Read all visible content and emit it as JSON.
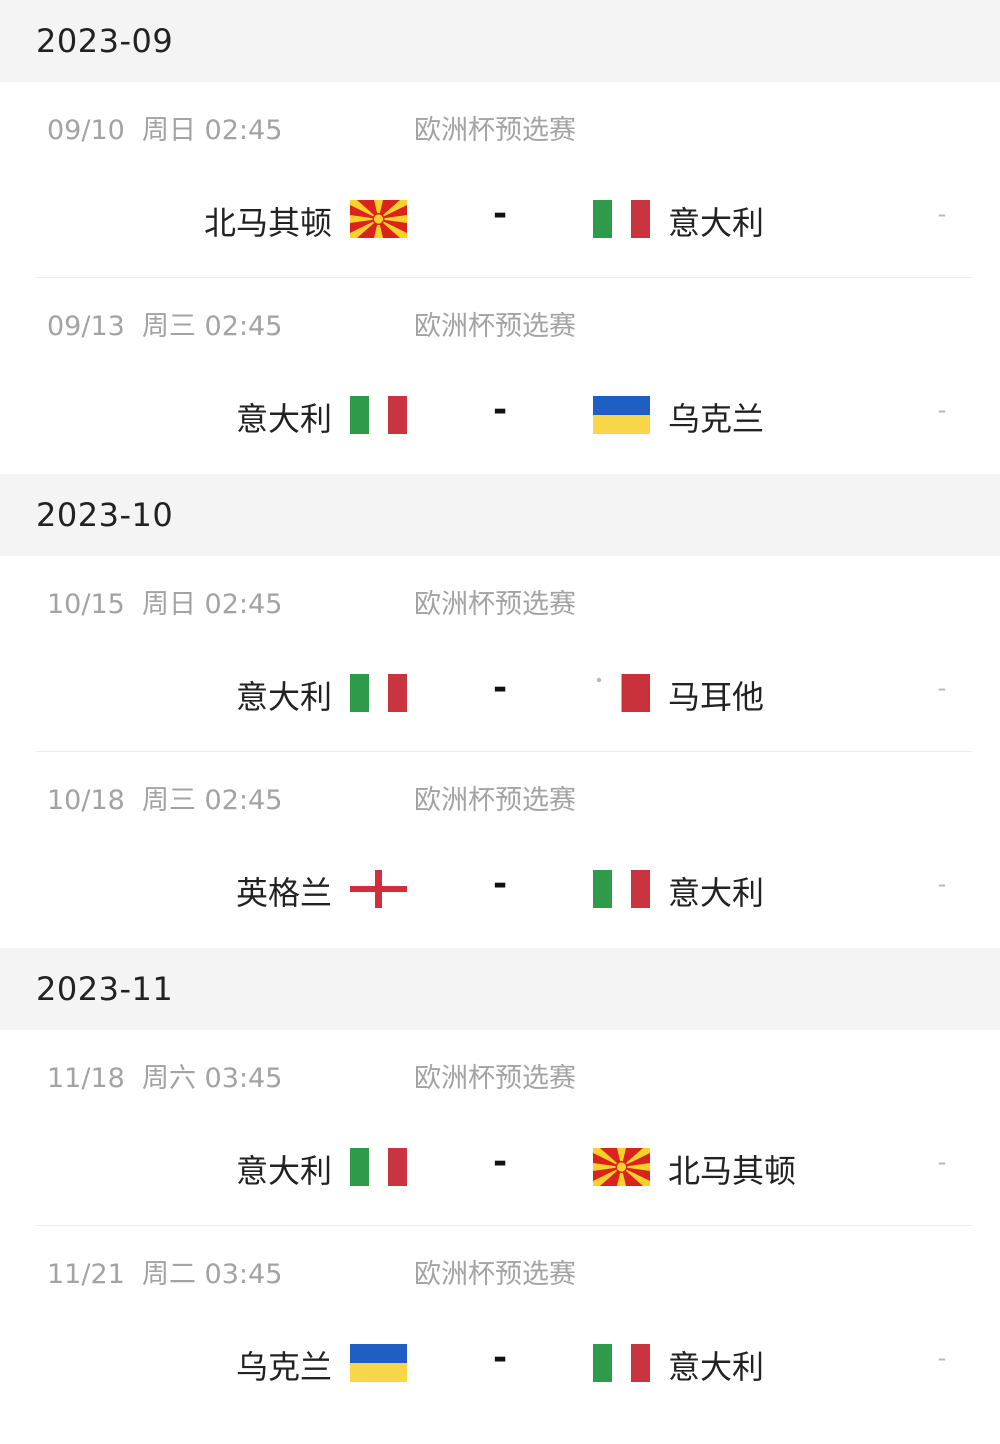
{
  "months": [
    {
      "label": "2023-09",
      "matches": [
        {
          "datetime": "09/10  周日 02:45",
          "competition": "欧洲杯预选赛",
          "home": {
            "name": "北马其顿",
            "flag": "north-macedonia"
          },
          "away": {
            "name": "意大利",
            "flag": "italy"
          },
          "separator": "-",
          "result": "-"
        },
        {
          "datetime": "09/13  周三 02:45",
          "competition": "欧洲杯预选赛",
          "home": {
            "name": "意大利",
            "flag": "italy"
          },
          "away": {
            "name": "乌克兰",
            "flag": "ukraine"
          },
          "separator": "-",
          "result": "-"
        }
      ]
    },
    {
      "label": "2023-10",
      "matches": [
        {
          "datetime": "10/15  周日 02:45",
          "competition": "欧洲杯预选赛",
          "home": {
            "name": "意大利",
            "flag": "italy"
          },
          "away": {
            "name": "马耳他",
            "flag": "malta"
          },
          "separator": "-",
          "result": "-"
        },
        {
          "datetime": "10/18  周三 02:45",
          "competition": "欧洲杯预选赛",
          "home": {
            "name": "英格兰",
            "flag": "england"
          },
          "away": {
            "name": "意大利",
            "flag": "italy"
          },
          "separator": "-",
          "result": "-"
        }
      ]
    },
    {
      "label": "2023-11",
      "matches": [
        {
          "datetime": "11/18  周六 03:45",
          "competition": "欧洲杯预选赛",
          "home": {
            "name": "意大利",
            "flag": "italy"
          },
          "away": {
            "name": "北马其顿",
            "flag": "north-macedonia"
          },
          "separator": "-",
          "result": "-"
        },
        {
          "datetime": "11/21  周二 03:45",
          "competition": "欧洲杯预选赛",
          "home": {
            "name": "乌克兰",
            "flag": "ukraine"
          },
          "away": {
            "name": "意大利",
            "flag": "italy"
          },
          "separator": "-",
          "result": "-"
        }
      ]
    }
  ],
  "colors": {
    "header_bg": "#f4f4f4",
    "muted_text": "#a3a3a3",
    "team_text": "#222222",
    "italy_green": "#2f9a4a",
    "italy_red": "#c8353f",
    "ukraine_blue": "#1f5fc4",
    "ukraine_yellow": "#f7d64a",
    "macedonia_red": "#d9231c",
    "macedonia_yellow": "#f8d12a",
    "england_red": "#d22f3b",
    "malta_red": "#c8303a"
  }
}
